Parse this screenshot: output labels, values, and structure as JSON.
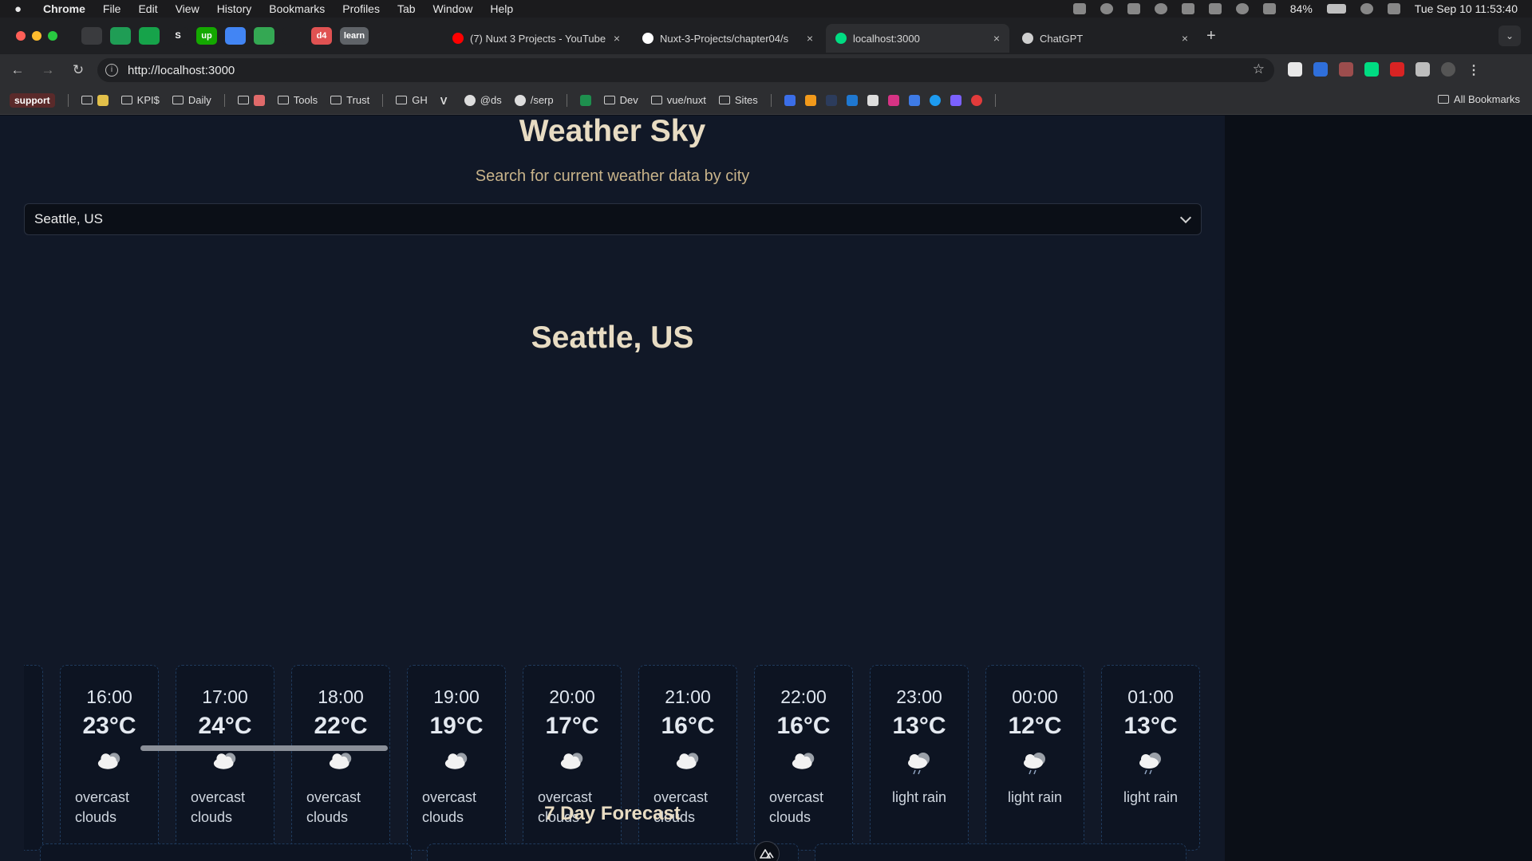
{
  "menubar": {
    "apple": "",
    "items": [
      "Chrome",
      "File",
      "Edit",
      "View",
      "History",
      "Bookmarks",
      "Profiles",
      "Tab",
      "Window",
      "Help"
    ],
    "battery": "84%",
    "datetime": "Tue Sep 10  11:53:40"
  },
  "pinned_tabs": [
    {
      "name": "pinned-tab-1",
      "label": "",
      "color": "#3a3b3e"
    },
    {
      "name": "pinned-tab-2",
      "label": "",
      "color": "#1f9d55"
    },
    {
      "name": "pinned-tab-3",
      "label": "",
      "color": "#16a34a"
    },
    {
      "name": "pinned-tab-4",
      "label": "S",
      "color": "#1f2023"
    },
    {
      "name": "pinned-tab-5",
      "label": "up",
      "color": "#14a800"
    },
    {
      "name": "pinned-tab-6",
      "label": "",
      "color": "#4285f4"
    },
    {
      "name": "pinned-tab-7",
      "label": "",
      "color": "#34a853"
    },
    {
      "name": "pinned-tab-8",
      "label": "",
      "color": "#1f2023"
    },
    {
      "name": "pinned-tab-9",
      "label": "d4",
      "color": "#e05252"
    },
    {
      "name": "pinned-tab-10",
      "label": "learn",
      "color": "#5f6368"
    }
  ],
  "tabs": [
    {
      "title": "(7) Nuxt 3 Projects - YouTube",
      "favicon_color": "#ff0000",
      "active": false
    },
    {
      "title": "Nuxt-3-Projects/chapter04/s",
      "favicon_color": "#ffffff",
      "active": false
    },
    {
      "title": "localhost:3000",
      "favicon_color": "#00dc82",
      "active": true
    },
    {
      "title": "ChatGPT",
      "favicon_color": "#cfcfcf",
      "active": false
    }
  ],
  "toolbar": {
    "url": "http://localhost:3000"
  },
  "bookmarks": {
    "support": "support",
    "items": [
      "KPI$",
      "Daily",
      "Tools",
      "Trust",
      "GH",
      "@ds",
      "/serp",
      "Dev",
      "vue/nuxt",
      "Sites"
    ],
    "all": "All Bookmarks"
  },
  "app": {
    "title": "Weather Sky",
    "subtitle": "Search for current weather data by city",
    "selected_city": "Seattle, US",
    "city_heading": "Seattle, US",
    "hourly": [
      {
        "time": "16:00",
        "temp": "23°C",
        "desc": "overcast clouds",
        "icon": "overcast-clouds-icon"
      },
      {
        "time": "17:00",
        "temp": "24°C",
        "desc": "overcast clouds",
        "icon": "overcast-clouds-icon"
      },
      {
        "time": "18:00",
        "temp": "22°C",
        "desc": "overcast clouds",
        "icon": "overcast-clouds-icon"
      },
      {
        "time": "19:00",
        "temp": "19°C",
        "desc": "overcast clouds",
        "icon": "overcast-clouds-icon"
      },
      {
        "time": "20:00",
        "temp": "17°C",
        "desc": "overcast clouds",
        "icon": "overcast-clouds-icon"
      },
      {
        "time": "21:00",
        "temp": "16°C",
        "desc": "overcast clouds",
        "icon": "overcast-clouds-icon"
      },
      {
        "time": "22:00",
        "temp": "16°C",
        "desc": "overcast clouds",
        "icon": "overcast-clouds-icon"
      },
      {
        "time": "23:00",
        "temp": "13°C",
        "desc": "light rain",
        "icon": "light-rain-icon"
      },
      {
        "time": "00:00",
        "temp": "12°C",
        "desc": "light rain",
        "icon": "light-rain-icon"
      },
      {
        "time": "01:00",
        "temp": "13°C",
        "desc": "light rain",
        "icon": "light-rain-icon"
      }
    ],
    "forecast_title": "7 Day Forecast"
  },
  "colors": {
    "accent_title": "#e8dcc3",
    "subtitle": "#c8b38a",
    "card_bg": "#111827",
    "page_bg": "#0b0f17",
    "card_border": "#1f3a5c"
  }
}
